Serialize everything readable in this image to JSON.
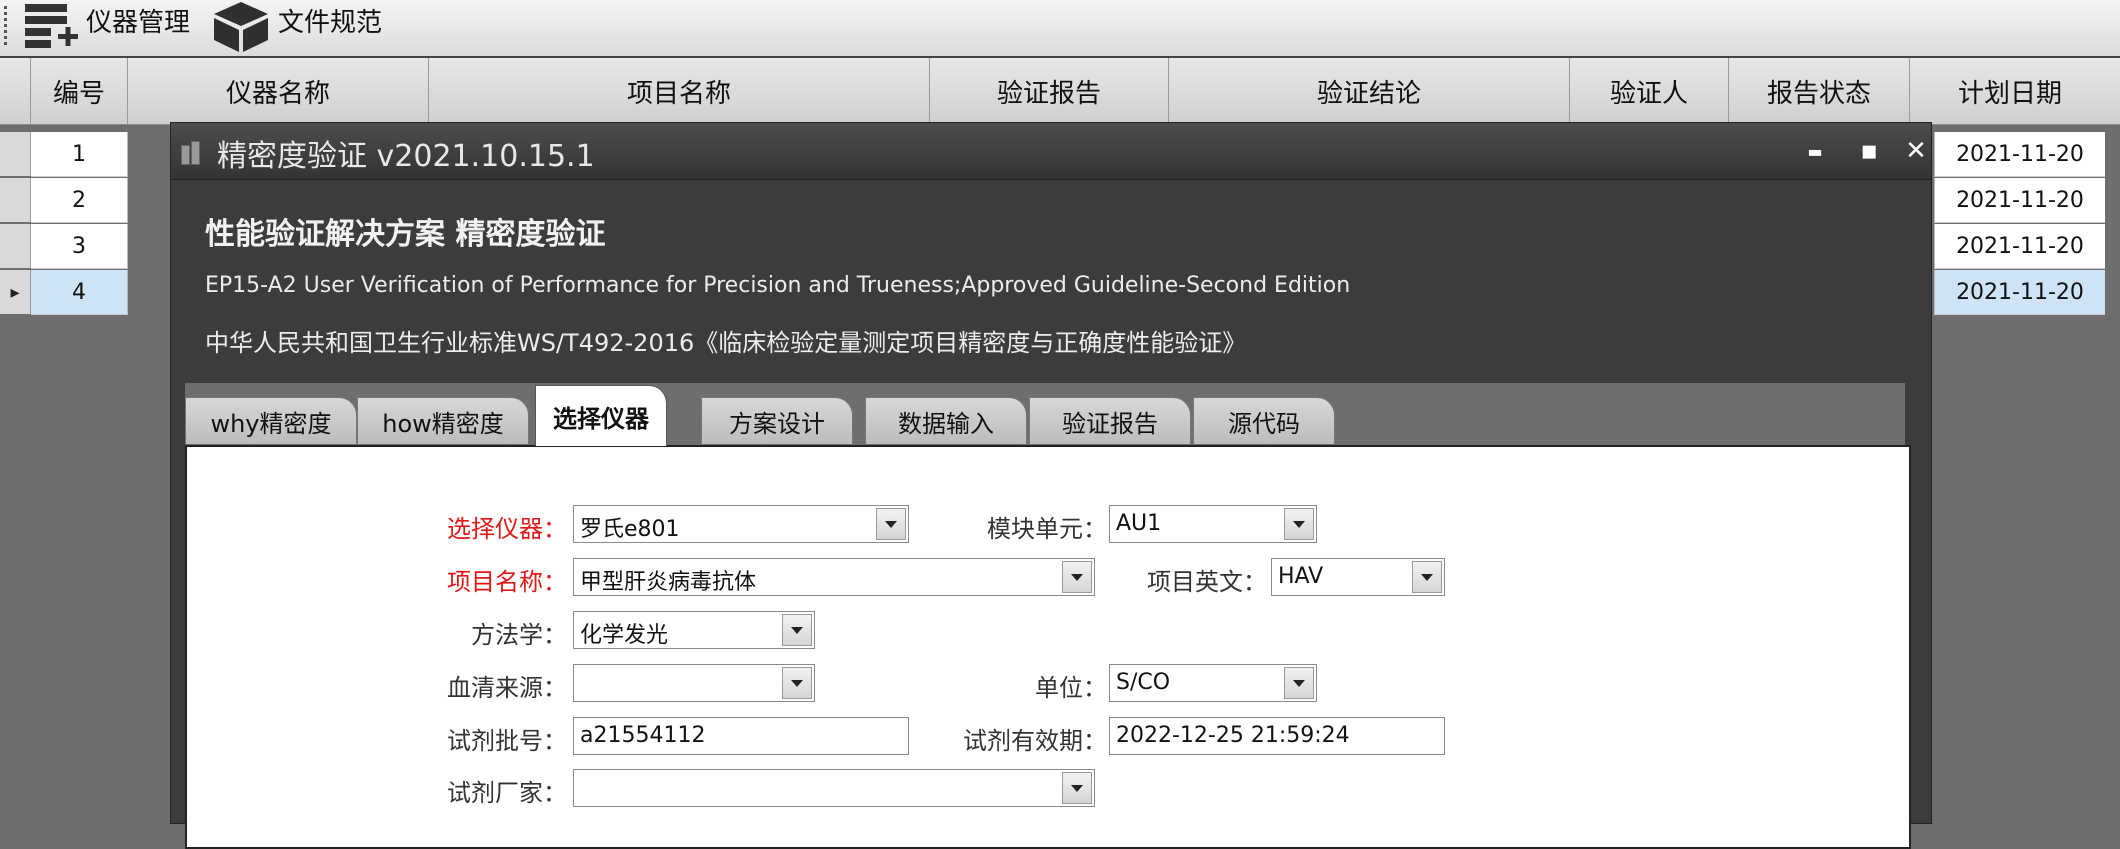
{
  "toolbar": {
    "items": [
      {
        "label": "仪器管理",
        "icon": "table-add-icon"
      },
      {
        "label": "文件规范",
        "icon": "cube-icon"
      }
    ]
  },
  "grid": {
    "columns": [
      "编号",
      "仪器名称",
      "项目名称",
      "验证报告",
      "验证结论",
      "验证人",
      "报告状态",
      "计划日期"
    ],
    "rows": [
      {
        "num": "1",
        "date": "2021-11-20"
      },
      {
        "num": "2",
        "date": "2021-11-20"
      },
      {
        "num": "3",
        "date": "2021-11-20"
      },
      {
        "num": "4",
        "date": "2021-11-20",
        "selected": true
      }
    ],
    "selection_marker": "▸"
  },
  "dialog": {
    "title": "精密度验证  v2021.10.15.1",
    "controls": {
      "minimize": "▬",
      "maximize": "▪",
      "close": "✕"
    },
    "header": {
      "title": "性能验证解决方案 精密度验证",
      "line1": "EP15-A2 User Verification of Performance for Precision and Trueness;Approved Guideline-Second Edition",
      "line2": "中华人民共和国卫生行业标准WS/T492-2016《临床检验定量测定项目精密度与正确度性能验证》"
    },
    "tabs": [
      "why精密度",
      "how精密度",
      "选择仪器",
      "方案设计",
      "数据输入",
      "验证报告",
      "源代码"
    ],
    "active_tab": "选择仪器",
    "form": {
      "instrument": {
        "label": "选择仪器：",
        "value": "罗氏e801"
      },
      "module": {
        "label": "模块单元：",
        "value": "AU1"
      },
      "item_name": {
        "label": "项目名称：",
        "value": "甲型肝炎病毒抗体"
      },
      "item_en": {
        "label": "项目英文：",
        "value": "HAV"
      },
      "method": {
        "label": "方法学：",
        "value": "化学发光"
      },
      "serum_source": {
        "label": "血清来源：",
        "value": ""
      },
      "unit": {
        "label": "单位：",
        "value": "S/CO"
      },
      "reagent_lot": {
        "label": "试剂批号：",
        "value": "a21554112"
      },
      "reagent_expiry": {
        "label": "试剂有效期：",
        "value": "2022-12-25 21:59:24"
      },
      "reagent_maker": {
        "label": "试剂厂家：",
        "value": ""
      }
    }
  },
  "colors": {
    "required_label": "#e01818",
    "selected_row": "#cfe3f7",
    "dialog_bg": "#3c3c3c"
  }
}
